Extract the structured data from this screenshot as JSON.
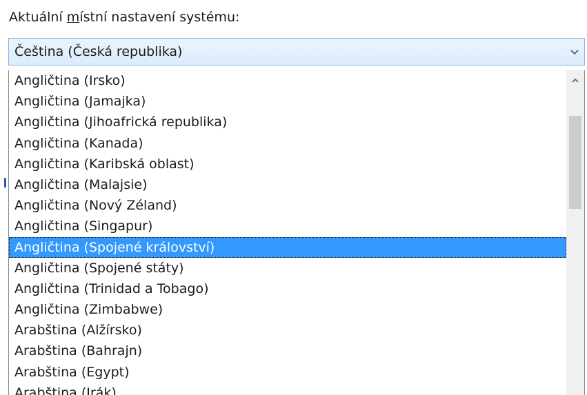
{
  "locale": {
    "label_prefix": "Aktuální ",
    "label_accel": "m",
    "label_suffix": "ístní nastavení systému:",
    "selected_value": "Čeština (Česká republika)",
    "items": [
      "Angličtina (Irsko)",
      "Angličtina (Jamajka)",
      "Angličtina (Jihoafrická republika)",
      "Angličtina (Kanada)",
      "Angličtina (Karibská oblast)",
      "Angličtina (Malajsie)",
      "Angličtina (Nový Zéland)",
      "Angličtina (Singapur)",
      "Angličtina (Spojené království)",
      "Angličtina (Spojené státy)",
      "Angličtina (Trinidad a Tobago)",
      "Angličtina (Zimbabwe)",
      "Arabština (Alžírsko)",
      "Arabština (Bahrajn)",
      "Arabština (Egypt)",
      "Arabština (Irák)"
    ],
    "highlighted_index": 8
  },
  "icons": {
    "dropdown": "chevron-down-icon",
    "scroll_up": "chevron-up-icon"
  },
  "colors": {
    "selection": "#3399ff",
    "combo_border": "#7eb4ea"
  }
}
